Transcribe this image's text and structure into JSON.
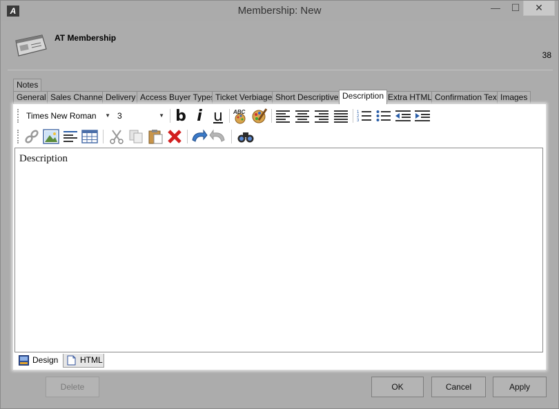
{
  "window": {
    "title": "Membership: New",
    "minimize_glyph": "—",
    "maximize_glyph": "☐",
    "close_glyph": "✕"
  },
  "header": {
    "title": "AT Membership",
    "count": "38",
    "icon": "membership-card-icon"
  },
  "tabs": {
    "row1": [
      {
        "label": "Notes"
      }
    ],
    "row2": [
      {
        "label": "General"
      },
      {
        "label": "Sales Channel"
      },
      {
        "label": "Delivery"
      },
      {
        "label": "Access Buyer Types"
      },
      {
        "label": "Ticket Verbiage"
      },
      {
        "label": "Short Descriptives"
      },
      {
        "label": "Description",
        "active": true
      },
      {
        "label": "Extra HTML"
      },
      {
        "label": "Confirmation Text"
      },
      {
        "label": "Images"
      }
    ]
  },
  "editor": {
    "font_family": "Times New Roman",
    "font_size": "3",
    "bold_glyph": "b",
    "italic_glyph": "i",
    "underline_glyph": "u",
    "spell_glyph": "ABC",
    "content": "Description",
    "mode_tabs": {
      "design": "Design",
      "html": "HTML"
    }
  },
  "buttons": {
    "delete": "Delete",
    "ok": "OK",
    "cancel": "Cancel",
    "apply": "Apply"
  }
}
